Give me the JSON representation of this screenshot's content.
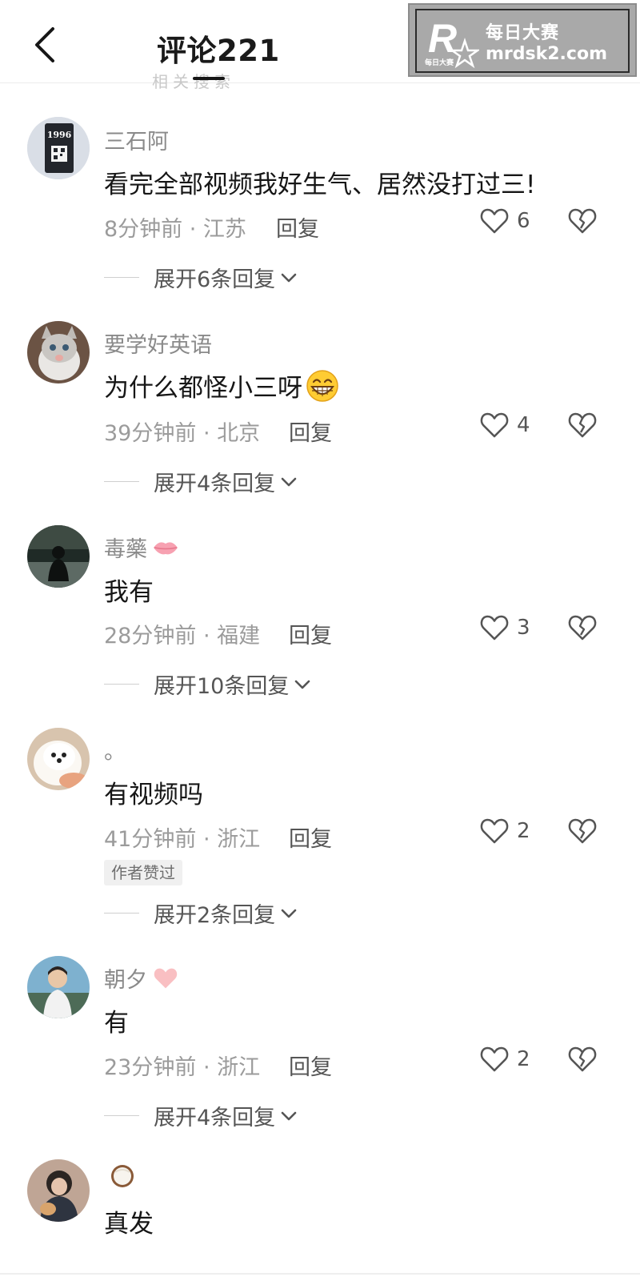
{
  "header": {
    "title": "评论221",
    "ghost_text": "相关搜索"
  },
  "watermark": {
    "logo_text": "R",
    "logo_sub": "每日大赛",
    "cn": "每日大赛",
    "url": "mrdsk2.com"
  },
  "reply_label": "回复",
  "comments": [
    {
      "username": "三石阿",
      "text": "看完全部视频我好生气、居然没打过三!",
      "time": "8分钟前 · 江苏",
      "likes": "6",
      "expand": "展开6条回复"
    },
    {
      "username": "要学好英语",
      "text": "为什么都怪小三呀",
      "time": "39分钟前 · 北京",
      "likes": "4",
      "expand": "展开4条回复"
    },
    {
      "username": "毒藥",
      "text": "我有",
      "time": "28分钟前 · 福建",
      "likes": "3",
      "expand": "展开10条回复"
    },
    {
      "username": "。",
      "text": "有视频吗",
      "time": "41分钟前 · 浙江",
      "likes": "2",
      "badge": "作者赞过",
      "expand": "展开2条回复"
    },
    {
      "username": "朝夕",
      "text": "有",
      "time": "23分钟前 · 浙江",
      "likes": "2",
      "expand": "展开4条回复"
    },
    {
      "username": "",
      "text": "真发"
    }
  ],
  "avatar1_text": "1996",
  "colors": {
    "text": "#161616",
    "muted": "#9b9b9b",
    "like": "#555555"
  }
}
